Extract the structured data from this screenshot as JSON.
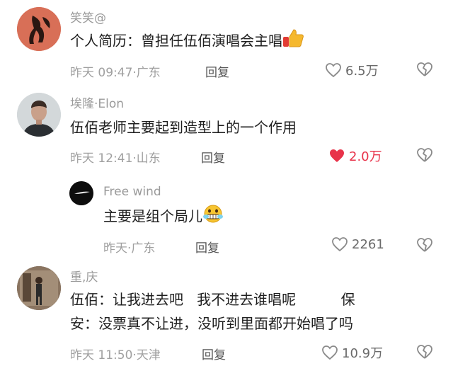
{
  "comments": [
    {
      "name": "笑笑@",
      "text": "个人简历：曾担任伍佰演唱会主唱",
      "time": "昨天 09:47·广东",
      "reply": "回复",
      "likes": "6.5万",
      "liked": false,
      "avatar_icon": "silhouette-avatar-icon"
    },
    {
      "name": "埃隆·Elon",
      "text": "伍佰老师主要起到造型上的一个作用",
      "time": "昨天 12:41·山东",
      "reply": "回复",
      "likes": "2.0万",
      "liked": true,
      "avatar_icon": "man-portrait-avatar-icon"
    },
    {
      "name": "Free wind",
      "text": "主要是组个局儿",
      "time": "昨天·广东",
      "reply": "回复",
      "likes": "2261",
      "liked": false,
      "avatar_icon": "dark-comet-avatar-icon"
    },
    {
      "name": "重,庆",
      "text_line1": "伍佰：让我进去吧   我不进去谁唱呢          保",
      "text_line2": "安：没票真不让进，没听到里面都开始唱了吗",
      "time": "昨天 11:50·天津",
      "reply": "回复",
      "likes": "10.9万",
      "liked": false,
      "avatar_icon": "standing-person-avatar-icon"
    }
  ],
  "colors": {
    "like_active": "#e8334a",
    "meta": "#a0a0a0",
    "name": "#9a9a9a"
  }
}
